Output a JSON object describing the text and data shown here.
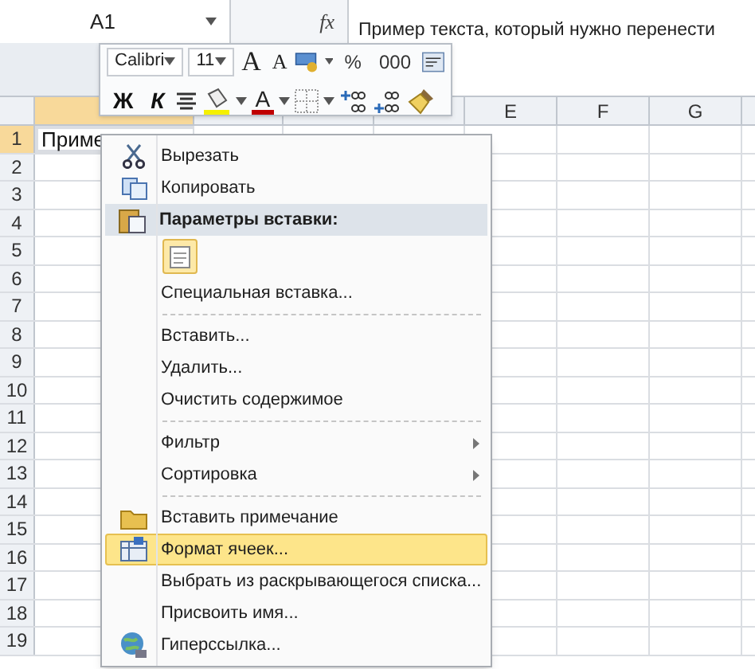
{
  "name_box": "A1",
  "fx": "fx",
  "formula": "Пример текста, который нужно перенести",
  "columns": [
    "",
    "",
    "",
    "",
    "E",
    "F",
    "G"
  ],
  "rows": [
    "1",
    "2",
    "3",
    "4",
    "5",
    "6",
    "7",
    "8",
    "9",
    "10",
    "11",
    "12",
    "13",
    "14",
    "15",
    "16",
    "17",
    "18",
    "19"
  ],
  "cell_a1": "Приме",
  "toolbar": {
    "font": "Calibri",
    "size": "11",
    "row1": [
      {
        "kind": "grow",
        "label": "A"
      },
      {
        "kind": "shrink",
        "label": "A"
      },
      {
        "kind": "money"
      },
      {
        "kind": "caret"
      },
      {
        "kind": "text",
        "label": "%"
      },
      {
        "kind": "text",
        "label": "000"
      },
      {
        "kind": "wrap"
      }
    ],
    "row2": [
      {
        "kind": "bold",
        "label": "Ж"
      },
      {
        "kind": "italic",
        "label": "К"
      },
      {
        "kind": "align"
      },
      {
        "kind": "fill"
      },
      {
        "kind": "caret"
      },
      {
        "kind": "fontcolor",
        "label": "A"
      },
      {
        "kind": "caret"
      },
      {
        "kind": "borders"
      },
      {
        "kind": "caret"
      },
      {
        "kind": "incdec"
      },
      {
        "kind": "decdec"
      },
      {
        "kind": "brush"
      }
    ]
  },
  "menu": [
    {
      "kind": "cut",
      "label": "Вырезать",
      "submenu": false,
      "selected": false
    },
    {
      "kind": "copy",
      "label": "Копировать",
      "submenu": false,
      "selected": false
    },
    {
      "kind": "header",
      "label": "Параметры вставки:"
    },
    {
      "kind": "paste-option"
    },
    {
      "kind": "item",
      "label": "Специальная вставка...",
      "submenu": false,
      "selected": false
    },
    {
      "kind": "separator"
    },
    {
      "kind": "item",
      "label": "Вставить...",
      "submenu": false,
      "selected": false
    },
    {
      "kind": "item",
      "label": "Удалить...",
      "submenu": false,
      "selected": false
    },
    {
      "kind": "item",
      "label": "Очистить содержимое",
      "submenu": false,
      "selected": false
    },
    {
      "kind": "separator"
    },
    {
      "kind": "item",
      "label": "Фильтр",
      "submenu": true,
      "selected": false
    },
    {
      "kind": "item",
      "label": "Сортировка",
      "submenu": true,
      "selected": false
    },
    {
      "kind": "separator"
    },
    {
      "kind": "folder",
      "label": "Вставить примечание",
      "submenu": false,
      "selected": false
    },
    {
      "kind": "format",
      "label": "Формат ячеек...",
      "submenu": false,
      "selected": true
    },
    {
      "kind": "item",
      "label": "Выбрать из раскрывающегося списка...",
      "submenu": false,
      "selected": false
    },
    {
      "kind": "item",
      "label": "Присвоить имя...",
      "submenu": false,
      "selected": false
    },
    {
      "kind": "hyperlink",
      "label": "Гиперссылка...",
      "submenu": false,
      "selected": false
    }
  ]
}
